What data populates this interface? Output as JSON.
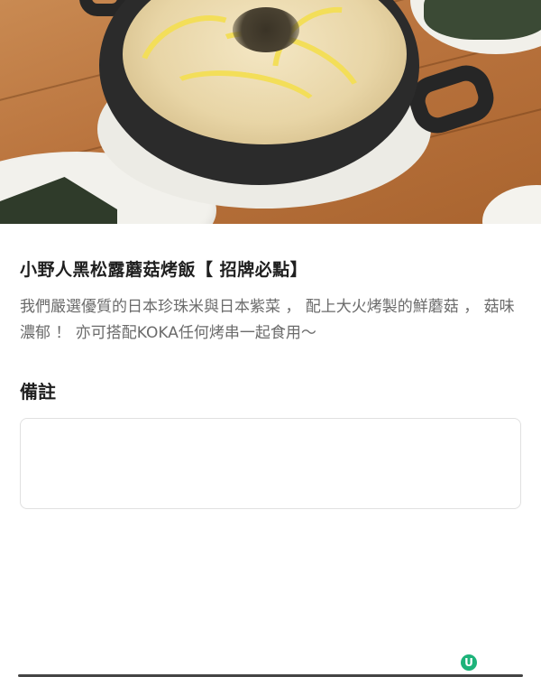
{
  "item": {
    "name": "小野人黑松露蘑菇烤飯【 招牌必點】",
    "description": "我們嚴選優質的日本珍珠米與日本紫菜 ， 配上大火烤製的鮮蘑菇 ， 菇味濃郁 ！ 亦可搭配KOKA任何烤串一起食用～"
  },
  "remarks": {
    "label": "備註",
    "value": "",
    "placeholder": ""
  },
  "badge": {
    "letter": "U",
    "icon": "brand-logo-icon",
    "color": "#1db37a"
  }
}
